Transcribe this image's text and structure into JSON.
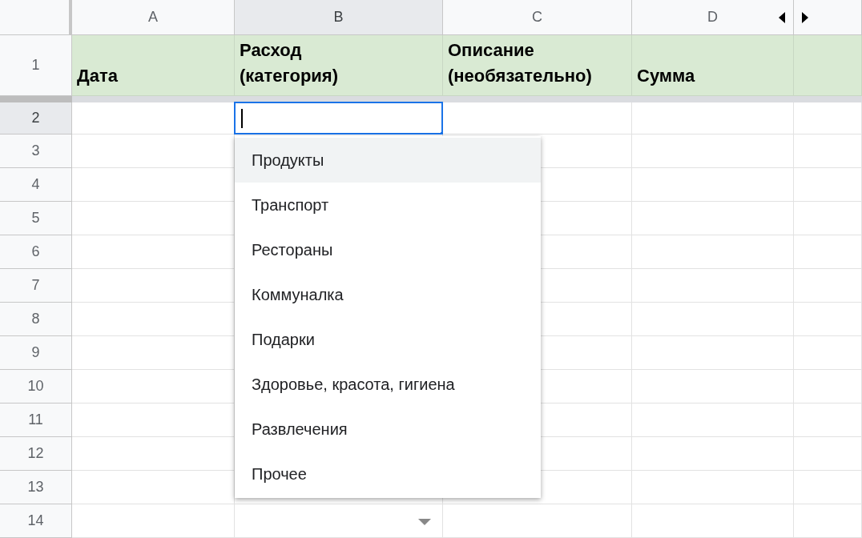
{
  "columns": [
    {
      "letter": "A",
      "selected": false
    },
    {
      "letter": "B",
      "selected": true
    },
    {
      "letter": "C",
      "selected": false
    },
    {
      "letter": "D",
      "selected": false
    },
    {
      "selected": false
    }
  ],
  "header_row": {
    "number": "1",
    "cells": [
      "Дата",
      "Расход\n(категория)",
      "Описание\n(необязательно)",
      "Сумма"
    ]
  },
  "rows": [
    {
      "number": "2",
      "selected": true
    },
    {
      "number": "3",
      "selected": false
    },
    {
      "number": "4",
      "selected": false
    },
    {
      "number": "5",
      "selected": false
    },
    {
      "number": "6",
      "selected": false
    },
    {
      "number": "7",
      "selected": false
    },
    {
      "number": "8",
      "selected": false
    },
    {
      "number": "9",
      "selected": false
    },
    {
      "number": "10",
      "selected": false
    },
    {
      "number": "11",
      "selected": false
    },
    {
      "number": "12",
      "selected": false
    },
    {
      "number": "13",
      "selected": false
    },
    {
      "number": "14",
      "selected": false
    }
  ],
  "dropdown": {
    "options": [
      {
        "label": "Продукты",
        "selected": true
      },
      {
        "label": "Транспорт",
        "selected": false
      },
      {
        "label": "Рестораны",
        "selected": false
      },
      {
        "label": "Коммуналка",
        "selected": false
      },
      {
        "label": "Подарки",
        "selected": false
      },
      {
        "label": "Здоровье, красота, гигиена",
        "selected": false
      },
      {
        "label": "Развлечения",
        "selected": false
      },
      {
        "label": "Прочее",
        "selected": false
      }
    ]
  }
}
